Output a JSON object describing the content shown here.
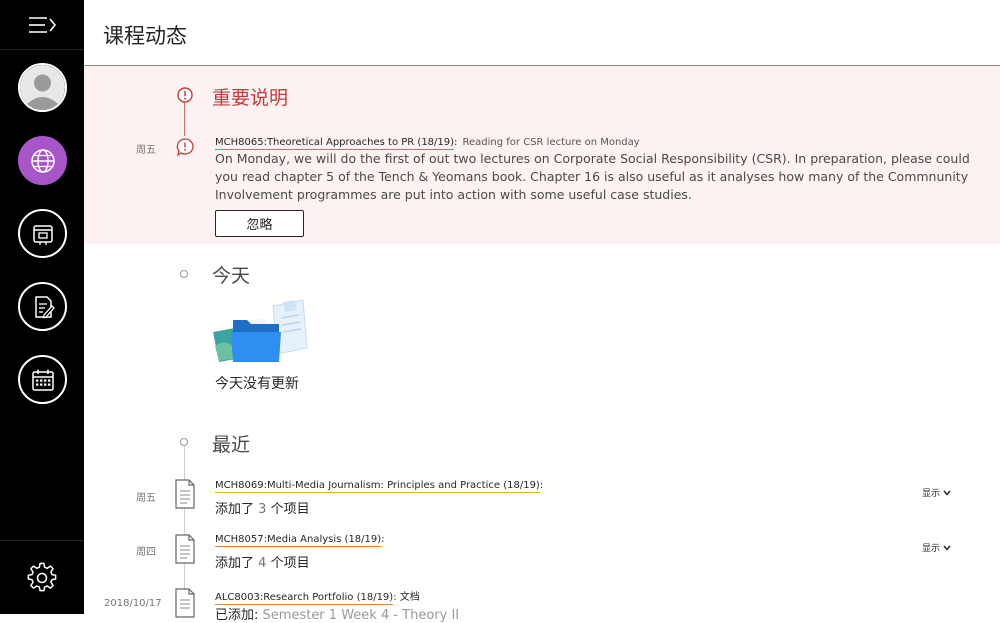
{
  "page": {
    "title": "课程动态"
  },
  "important": {
    "title": "重要说明",
    "item": {
      "day": "周五",
      "course": "MCH8065:Theoretical Approaches to PR (18/19)",
      "colon": ":",
      "subtitle": "Reading for CSR lecture on Monday",
      "body": "On Monday, we will do the first of out two lectures on Corporate Social Responsibility (CSR). In preparation, please could you read chapter 5 of the Tench & Yeomans book. Chapter 16 is also useful as it analyses how many of the Commnunity Involvement programmes are put into action with some useful case studies.",
      "dismiss_label": "忽略"
    }
  },
  "today": {
    "title": "今天",
    "empty_text": "今天没有更新"
  },
  "recent": {
    "title": "最近",
    "items": [
      {
        "day": "周五",
        "course": "MCH8069:Multi-Media Journalism: Principles and Practice (18/19)",
        "colon": ":",
        "added_prefix": "添加了",
        "count": "3",
        "suffix": "个项目",
        "show_label": "显示"
      },
      {
        "day": "周四",
        "course": "MCH8057:Media Analysis (18/19)",
        "colon": ":",
        "added_prefix": "添加了",
        "count": "4",
        "suffix": "个项目",
        "show_label": "显示"
      },
      {
        "day": "2018/10/17",
        "course": "ALC8003:Research Portfolio (18/19)",
        "colon": ":",
        "type": "文档",
        "added_prefix": "已添加:",
        "detail": "Semester 1 Week 4 - Theory II"
      }
    ]
  },
  "colors": {
    "active_nav": "#a855c8",
    "alert": "#c23b3b",
    "link_green": "#3cb371",
    "link_yellow": "#e0b020",
    "link_orange": "#e8833a"
  }
}
